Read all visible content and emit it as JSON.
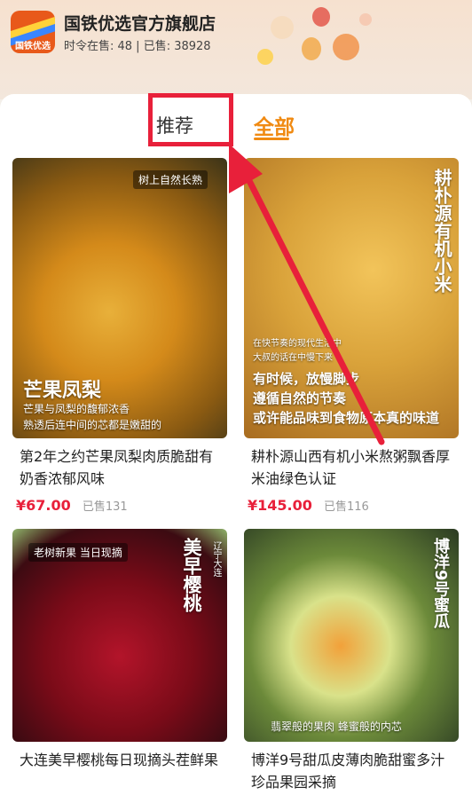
{
  "store": {
    "name": "国铁优选官方旗舰店",
    "stats": "时令在售: 48 | 已售: 38928",
    "logo_text": "国铁优选"
  },
  "tabs": {
    "recommend": "推荐",
    "all": "全部"
  },
  "products": [
    {
      "title": "第2年之约芒果凤梨肉质脆甜有奶香浓郁风味",
      "price": "¥67.00",
      "sold": "已售131",
      "overlay_tag": "树上自然长熟",
      "overlay_title": "芒果凤梨",
      "overlay_sub1": "芒果与凤梨的馥郁浓香",
      "overlay_sub2": "熟透后连中间的芯都是嫩甜的"
    },
    {
      "title": "耕朴源山西有机小米熬粥飘香厚米油绿色认证",
      "price": "¥145.00",
      "sold": "已售116",
      "overlay_vertical": "耕朴源有机小米",
      "overlay_sub1": "在快节奏的现代生活中",
      "overlay_sub2": "大叔的话在中慢下来",
      "overlay_line1": "有时候，放慢脚步",
      "overlay_line2": "遵循自然的节奏",
      "overlay_line3": "或许能品味到食物原本真的味道"
    },
    {
      "title": "大连美早樱桃每日现摘头茬鲜果",
      "overlay_tag": "老树新果 当日现摘",
      "overlay_vertical": "美早樱桃",
      "overlay_small_vertical": "辽宁大连"
    },
    {
      "title": "博洋9号甜瓜皮薄肉脆甜蜜多汁珍品果园采摘",
      "overlay_vertical": "博洋9号蜜瓜",
      "overlay_sub1": "翡翠般的果肉 蜂蜜般的内芯"
    }
  ]
}
